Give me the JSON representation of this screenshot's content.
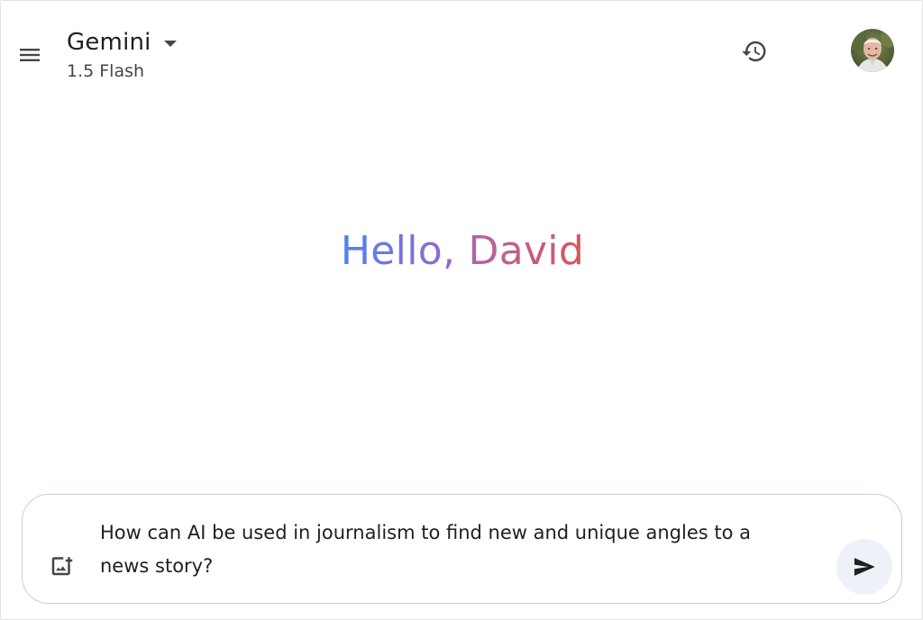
{
  "header": {
    "app_title": "Gemini",
    "model_label": "1.5 Flash",
    "menu_icon": "hamburger-menu-icon",
    "dropdown_icon": "caret-down-icon",
    "history_icon": "history-icon",
    "avatar_icon": "user-avatar"
  },
  "greeting": {
    "text": "Hello, David",
    "gradient_colors": [
      "#4b83f5",
      "#8f6ad2",
      "#c25f93",
      "#d5555f"
    ]
  },
  "prompt": {
    "value": "How can AI be used in journalism to find new and unique angles to a news story?",
    "image_icon": "add-image-icon",
    "send_icon": "send-icon"
  },
  "colors": {
    "text_primary": "#1f1f1f",
    "text_secondary": "#444746",
    "send_bg": "#eef2f8",
    "border": "#c9ccd1"
  }
}
